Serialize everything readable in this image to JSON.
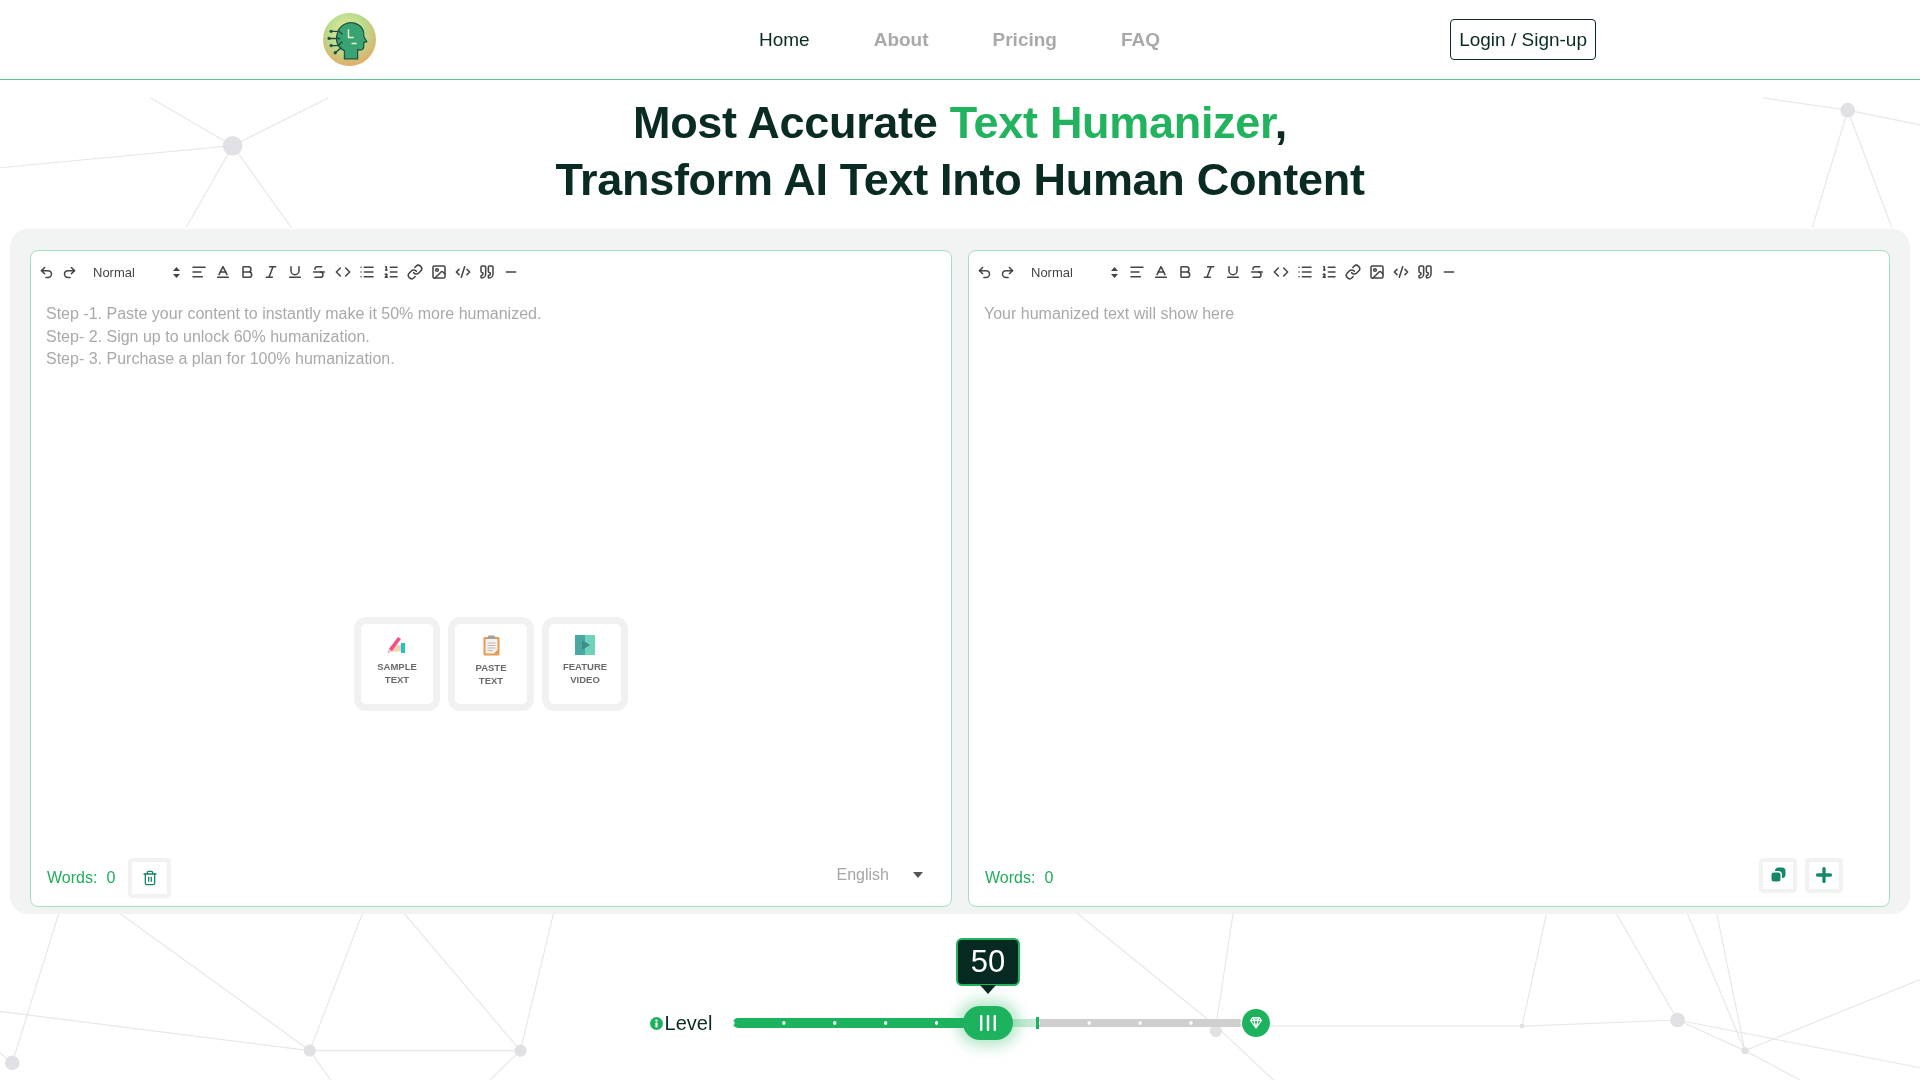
{
  "header": {
    "nav": [
      {
        "label": "Home",
        "selected": true
      },
      {
        "label": "About",
        "selected": false
      },
      {
        "label": "Pricing",
        "selected": false
      },
      {
        "label": "FAQ",
        "selected": false
      }
    ],
    "login_button": "Login / Sign-up"
  },
  "headline": {
    "lines": [
      [
        {
          "text": "Most Accurate ",
          "highlight": false
        },
        {
          "text": "Text Humanizer",
          "highlight": true
        },
        {
          "text": ",",
          "highlight": false
        }
      ],
      [
        {
          "text": "Transform AI Text Into Human Content",
          "highlight": false
        }
      ]
    ]
  },
  "editors": [
    {
      "kind": "input",
      "format_select": "Normal",
      "placeholder_lines": [
        "Step -1. Paste your content to instantly make it 50% more humanized.",
        "Step- 2. Sign up to unlock 60% humanization.",
        "Step- 3. Purchase a plan for 100% humanization."
      ],
      "quick_actions": [
        {
          "kind": "sample",
          "label": "SAMPLE TEXT"
        },
        {
          "kind": "paste",
          "label": "PASTE TEXT"
        },
        {
          "kind": "video",
          "label": "FEATURE VIDEO"
        }
      ],
      "words_label": "Words:",
      "word_count": "0",
      "language": "English"
    },
    {
      "kind": "output",
      "format_select": "Normal",
      "placeholder_lines": [
        "Your humanized text will show here"
      ],
      "words_label": "Words:",
      "word_count": "0"
    }
  ],
  "slider": {
    "label": "Level",
    "level": 0.5,
    "value_label": "50",
    "unlocked": {
      "level": 0.6
    }
  }
}
